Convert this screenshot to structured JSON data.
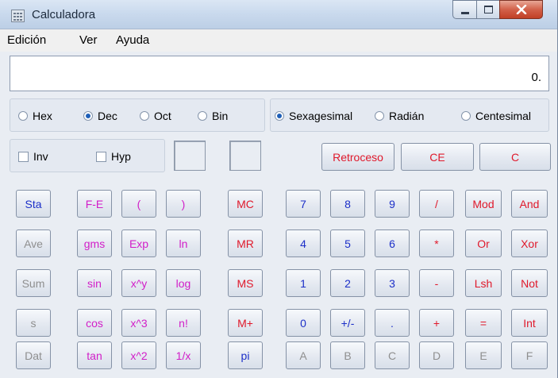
{
  "window": {
    "title": "Calculadora"
  },
  "menu": [
    "Edición",
    "Ver",
    "Ayuda"
  ],
  "display": {
    "value": "0."
  },
  "base_options": [
    {
      "label": "Hex",
      "selected": false
    },
    {
      "label": "Dec",
      "selected": true
    },
    {
      "label": "Oct",
      "selected": false
    },
    {
      "label": "Bin",
      "selected": false
    }
  ],
  "angle_options": [
    {
      "label": "Sexagesimal",
      "selected": true
    },
    {
      "label": "Radián",
      "selected": false
    },
    {
      "label": "Centesimal",
      "selected": false
    }
  ],
  "checkboxes": [
    {
      "label": "Inv",
      "checked": false
    },
    {
      "label": "Hyp",
      "checked": false
    }
  ],
  "edit_buttons": [
    "Retroceso",
    "CE",
    "C"
  ],
  "stat_buttons": [
    "Sta",
    "Ave",
    "Sum",
    "s",
    "Dat"
  ],
  "sci_col1": [
    "F-E",
    "gms",
    "sin",
    "cos",
    "tan"
  ],
  "sci_col2": [
    "(",
    "Exp",
    "x^y",
    "x^3",
    "x^2"
  ],
  "sci_col3": [
    ")",
    "ln",
    "log",
    "n!",
    "1/x"
  ],
  "memory_buttons": [
    "MC",
    "MR",
    "MS",
    "M+",
    "pi"
  ],
  "keypad": [
    [
      "7",
      "8",
      "9",
      "/",
      "Mod",
      "And"
    ],
    [
      "4",
      "5",
      "6",
      "*",
      "Or",
      "Xor"
    ],
    [
      "1",
      "2",
      "3",
      "-",
      "Lsh",
      "Not"
    ],
    [
      "0",
      "+/-",
      ".",
      "+",
      "=",
      "Int"
    ],
    [
      "A",
      "B",
      "C",
      "D",
      "E",
      "F"
    ]
  ],
  "colors": {
    "blue_text": "#1c2fc8",
    "red_text": "#e0192b",
    "magenta_text": "#d21ec8",
    "disabled_text": "#8f8f8f",
    "selected_radio": "#1e5fb8"
  }
}
